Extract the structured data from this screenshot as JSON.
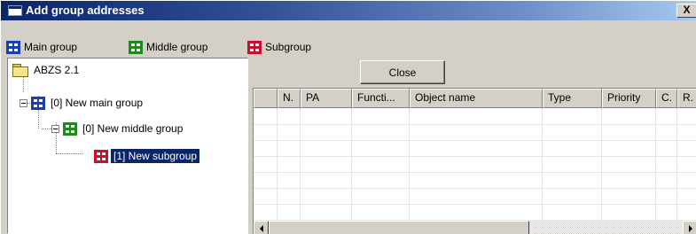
{
  "window": {
    "title": "Add group addresses",
    "close_glyph": "X"
  },
  "toolbar": {
    "main_group_label": "Main group",
    "middle_group_label": "Middle group",
    "subgroup_label": "Subgroup"
  },
  "tree": {
    "root": "ABZS 2.1",
    "main_group": "[0] New main group",
    "middle_group": "[0] New middle group",
    "subgroup": "[1] New subgroup"
  },
  "panel": {
    "close_label": "Close"
  },
  "grid": {
    "columns": [
      "N.",
      "PA",
      "Functi...",
      "Object name",
      "Type",
      "Priority",
      "C.",
      "R."
    ],
    "rows": []
  },
  "colors": {
    "main_group_icon": "#1a3fb3",
    "middle_group_icon": "#1d8a1d",
    "subgroup_icon": "#c8102e",
    "selection": "#0a246a"
  }
}
